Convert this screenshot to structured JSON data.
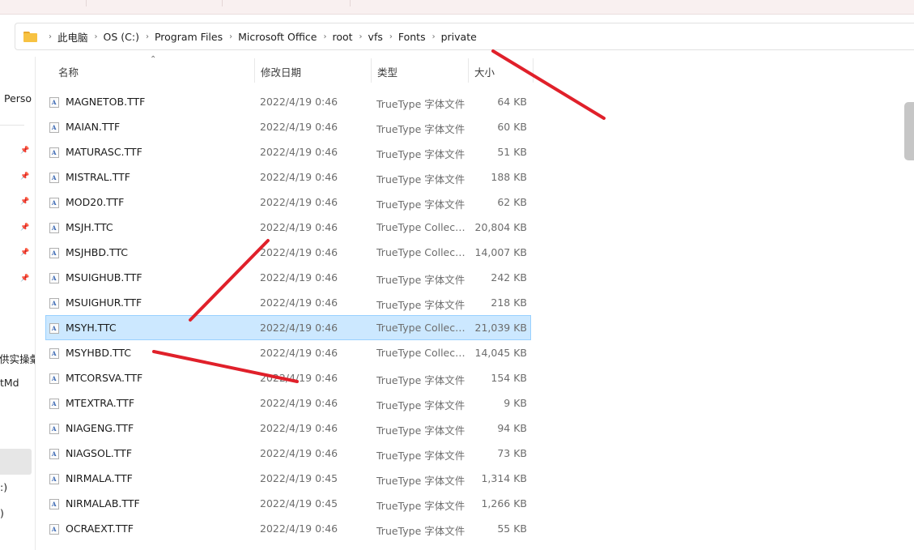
{
  "breadcrumb": {
    "items": [
      "此电脑",
      "OS (C:)",
      "Program Files",
      "Microsoft Office",
      "root",
      "vfs",
      "Fonts",
      "private"
    ],
    "separator": "›"
  },
  "nav": {
    "items": [
      {
        "label": "Perso"
      },
      {
        "label": "供实操彙"
      },
      {
        "label": "tMd"
      },
      {
        "label": ":)"
      },
      {
        "label": ")"
      }
    ]
  },
  "columns": {
    "name": "名称",
    "modified": "修改日期",
    "type": "类型",
    "size": "大小"
  },
  "files": [
    {
      "name": "MAGNETOB.TTF",
      "modified": "2022/4/19 0:46",
      "type": "TrueType 字体文件",
      "size": "64 KB"
    },
    {
      "name": "MAIAN.TTF",
      "modified": "2022/4/19 0:46",
      "type": "TrueType 字体文件",
      "size": "60 KB"
    },
    {
      "name": "MATURASC.TTF",
      "modified": "2022/4/19 0:46",
      "type": "TrueType 字体文件",
      "size": "51 KB"
    },
    {
      "name": "MISTRAL.TTF",
      "modified": "2022/4/19 0:46",
      "type": "TrueType 字体文件",
      "size": "188 KB"
    },
    {
      "name": "MOD20.TTF",
      "modified": "2022/4/19 0:46",
      "type": "TrueType 字体文件",
      "size": "62 KB"
    },
    {
      "name": "MSJH.TTC",
      "modified": "2022/4/19 0:46",
      "type": "TrueType Collect...",
      "size": "20,804 KB"
    },
    {
      "name": "MSJHBD.TTC",
      "modified": "2022/4/19 0:46",
      "type": "TrueType Collect...",
      "size": "14,007 KB"
    },
    {
      "name": "MSUIGHUB.TTF",
      "modified": "2022/4/19 0:46",
      "type": "TrueType 字体文件",
      "size": "242 KB"
    },
    {
      "name": "MSUIGHUR.TTF",
      "modified": "2022/4/19 0:46",
      "type": "TrueType 字体文件",
      "size": "218 KB"
    },
    {
      "name": "MSYH.TTC",
      "modified": "2022/4/19 0:46",
      "type": "TrueType Collect...",
      "size": "21,039 KB",
      "selected": true
    },
    {
      "name": "MSYHBD.TTC",
      "modified": "2022/4/19 0:46",
      "type": "TrueType Collect...",
      "size": "14,045 KB"
    },
    {
      "name": "MTCORSVA.TTF",
      "modified": "2022/4/19 0:46",
      "type": "TrueType 字体文件",
      "size": "154 KB"
    },
    {
      "name": "MTEXTRA.TTF",
      "modified": "2022/4/19 0:46",
      "type": "TrueType 字体文件",
      "size": "9 KB"
    },
    {
      "name": "NIAGENG.TTF",
      "modified": "2022/4/19 0:46",
      "type": "TrueType 字体文件",
      "size": "94 KB"
    },
    {
      "name": "NIAGSOL.TTF",
      "modified": "2022/4/19 0:46",
      "type": "TrueType 字体文件",
      "size": "73 KB"
    },
    {
      "name": "NIRMALA.TTF",
      "modified": "2022/4/19 0:45",
      "type": "TrueType 字体文件",
      "size": "1,314 KB"
    },
    {
      "name": "NIRMALAB.TTF",
      "modified": "2022/4/19 0:45",
      "type": "TrueType 字体文件",
      "size": "1,266 KB"
    },
    {
      "name": "OCRAEXT.TTF",
      "modified": "2022/4/19 0:46",
      "type": "TrueType 字体文件",
      "size": "55 KB"
    }
  ],
  "colors": {
    "selection_bg": "#cce8ff",
    "selection_border": "#99d1ff",
    "annotation": "#e0202a",
    "folder": "#f7c242"
  },
  "icons": {
    "folder": "folder-icon",
    "breadcrumb_separator": "chevron-right-icon",
    "pin": "pin-icon",
    "font_file": "font-file-icon",
    "sort": "sort-ascending-icon"
  }
}
